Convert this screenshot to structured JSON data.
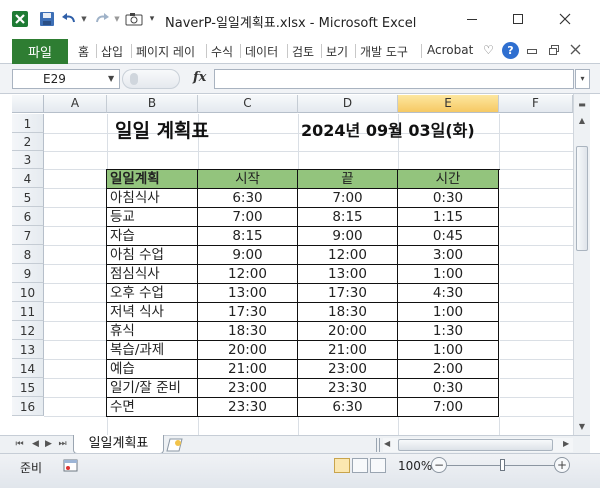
{
  "window": {
    "title": "NaverP-일일계획표.xlsx  -  Microsoft Excel",
    "minimize_icon": "minimize-icon",
    "restore_icon": "maximize-icon",
    "close_icon": "close-icon"
  },
  "quick_access": {
    "app_icon": "excel-icon",
    "save_icon": "save-icon",
    "undo_icon": "undo-icon",
    "redo_icon": "redo-icon",
    "camera_icon": "camera-icon",
    "customize_icon": "chevron-down-icon"
  },
  "ribbon": {
    "file_tab": "파일",
    "tabs": [
      "홈",
      "삽입",
      "페이지 레이",
      "수식",
      "데이터",
      "검토",
      "보기",
      "개발 도구",
      "Acrobat"
    ],
    "right_icons": [
      "heart-icon",
      "help-icon",
      "ribbon-minimize-icon",
      "restore-icon",
      "close-icon"
    ]
  },
  "formula_bar": {
    "name_box": "E29",
    "fx_label": "fx",
    "formula": ""
  },
  "columns": [
    "A",
    "B",
    "C",
    "D",
    "E",
    "F"
  ],
  "selected_column": "E",
  "rows": [
    "1",
    "2",
    "3",
    "4",
    "5",
    "6",
    "7",
    "8",
    "9",
    "10",
    "11",
    "12",
    "13",
    "14",
    "15",
    "16"
  ],
  "sheet": {
    "title": "일일 계획표",
    "date": "2024년 09월 03일(화)",
    "table": {
      "headers": [
        "일일계획",
        "시작",
        "끝",
        "시간"
      ],
      "header_color": "#93c47d",
      "rows": [
        [
          "아침식사",
          "6:30",
          "7:00",
          "0:30"
        ],
        [
          "등교",
          "7:00",
          "8:15",
          "1:15"
        ],
        [
          "자습",
          "8:15",
          "9:00",
          "0:45"
        ],
        [
          "아침 수업",
          "9:00",
          "12:00",
          "3:00"
        ],
        [
          "점심식사",
          "12:00",
          "13:00",
          "1:00"
        ],
        [
          "오후 수업",
          "13:00",
          "17:30",
          "4:30"
        ],
        [
          "저녁 식사",
          "17:30",
          "18:30",
          "1:00"
        ],
        [
          "휴식",
          "18:30",
          "20:00",
          "1:30"
        ],
        [
          "복습/과제",
          "20:00",
          "21:00",
          "1:00"
        ],
        [
          "예습",
          "21:00",
          "23:00",
          "2:00"
        ],
        [
          "일기/잘 준비",
          "23:00",
          "23:30",
          "0:30"
        ],
        [
          "수면",
          "23:30",
          "6:30",
          "7:00"
        ]
      ]
    }
  },
  "sheet_tabs": {
    "active": "일일계획표",
    "new_sheet_icon": "new-sheet-icon"
  },
  "status_bar": {
    "status": "준비",
    "zoom": "100%",
    "zoom_minus": "−",
    "zoom_plus": "+"
  }
}
